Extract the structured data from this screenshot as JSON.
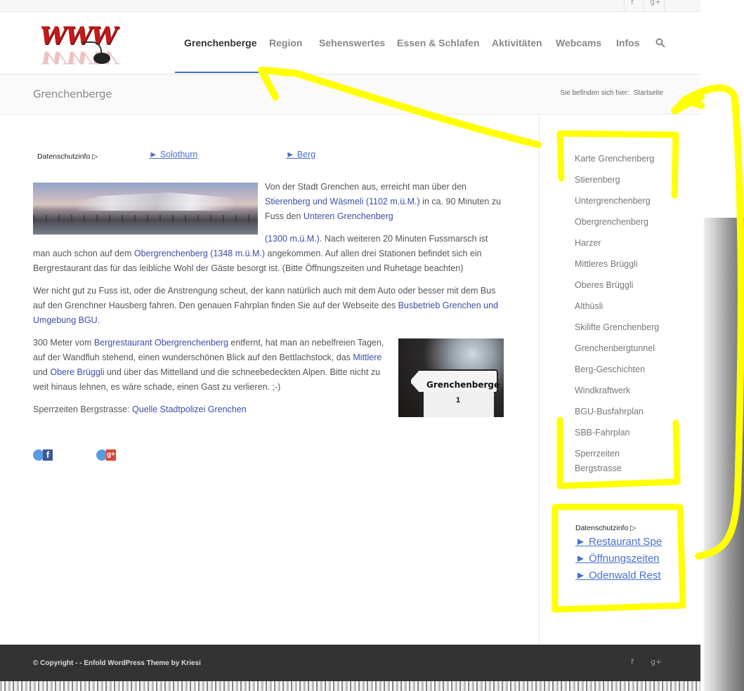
{
  "topbar": {
    "facebook": "f",
    "googleplus": "g+"
  },
  "logo": {
    "text": "WWW"
  },
  "nav": {
    "items": [
      {
        "label": "Grenchenberge",
        "active": true
      },
      {
        "label": "Region"
      },
      {
        "label": "Sehenswertes"
      },
      {
        "label": "Essen & Schlafen"
      },
      {
        "label": "Aktivitäten"
      },
      {
        "label": "Webcams"
      },
      {
        "label": "Infos"
      }
    ]
  },
  "titlebar": {
    "title": "Grenchenberge",
    "breadcrumb_prefix": "Sie befinden sich hier:",
    "breadcrumb_home": "Startseite"
  },
  "content": {
    "datenschutz": "Datenschutzinfo ▷",
    "link_solothurn": "► Solothurn",
    "link_berg": "► Berg",
    "p1a": "Von der Stadt Grenchen aus, erreicht man über den",
    "p1_link1": "Stierenberg und Wäsmeli (1102 m.ü.M.)",
    "p1b": " in ca. 90 Minuten zu Fuss den ",
    "p1_link2": "Unteren Grenchenberg",
    "p2_link1": "(1300 m.ü.M.)",
    "p2a": ". Nach weiteren 20 Minuten Fussmarsch ist man auch schon auf dem ",
    "p2_link2": "Obergrenchenberg (1348 m.ü.M.)",
    "p2b": " angekommen. Auf allen drei Stationen befindet sich ein Bergrestaurant das für das leibliche Wohl der Gäste besorgt ist. (Bitte Öffnungszeiten und Ruhetage beachten)",
    "p3a": "Wer nicht gut zu Fuss ist, oder die Anstrengung scheut, der kann natürlich auch mit dem Auto oder besser mit dem Bus auf den Grenchner Hausberg fahren. Den genauen Fahrplan finden Sie auf der Webseite des ",
    "p3_link": "Busbetrieb Grenchen und Umgebung BGU",
    "p3b": ".",
    "p4a": "300 Meter vom ",
    "p4_link1": "Bergrestaurant Obergrenchenberg",
    "p4b": " entfernt, hat man an nebelfreien Tagen, auf der Wandfluh stehend, einen wunderschönen Blick auf den Bettlachstock, das ",
    "p4_link2": "Mittlere",
    "p4c": " und ",
    "p4_link3": "Obere Brüggli",
    "p4d": " und über das Mittelland und die schneebedeckten Alpen. Bitte nicht zu weit hinaus lehnen, es wäre schade, einen Gast zu verlieren. ;-)",
    "p5a": "Sperrzeiten Bergstrasse: ",
    "p5_link": "Quelle Stadtpolizei Grenchen",
    "sign_text": "Grenchenberge",
    "sign_number": "1",
    "share_fb": "f",
    "share_gp": "g+"
  },
  "sidebar": {
    "items": [
      "Karte Grenchenberg",
      "Stierenberg",
      "Untergrenchenberg",
      "Obergrenchenberg",
      "Harzer",
      "Mittleres Brüggli",
      "Oberes Brüggli",
      "Althüsli",
      "Skilifte Grenchenberg",
      "Grenchenbergtunnel",
      "Berg-Geschichten",
      "Windkraftwerk",
      "BGU-Busfahrplan",
      "SBB-Fahrplan",
      "Sperrzeiten",
      "Bergstrasse"
    ],
    "widget_datenschutz": "Datenschutzinfo ▷",
    "widget_links": [
      "► Restaurant Spe",
      "► Öffnungszeiten",
      "► Odenwald Rest"
    ]
  },
  "footer": {
    "copyright": "© Copyright - - Enfold WordPress Theme by Kriesi",
    "facebook": "f",
    "googleplus": "g+"
  },
  "colors": {
    "link": "#3a4fa8",
    "accent": "#3a6fc4",
    "highlight": "#ffff00",
    "footer_bg": "#333333"
  }
}
